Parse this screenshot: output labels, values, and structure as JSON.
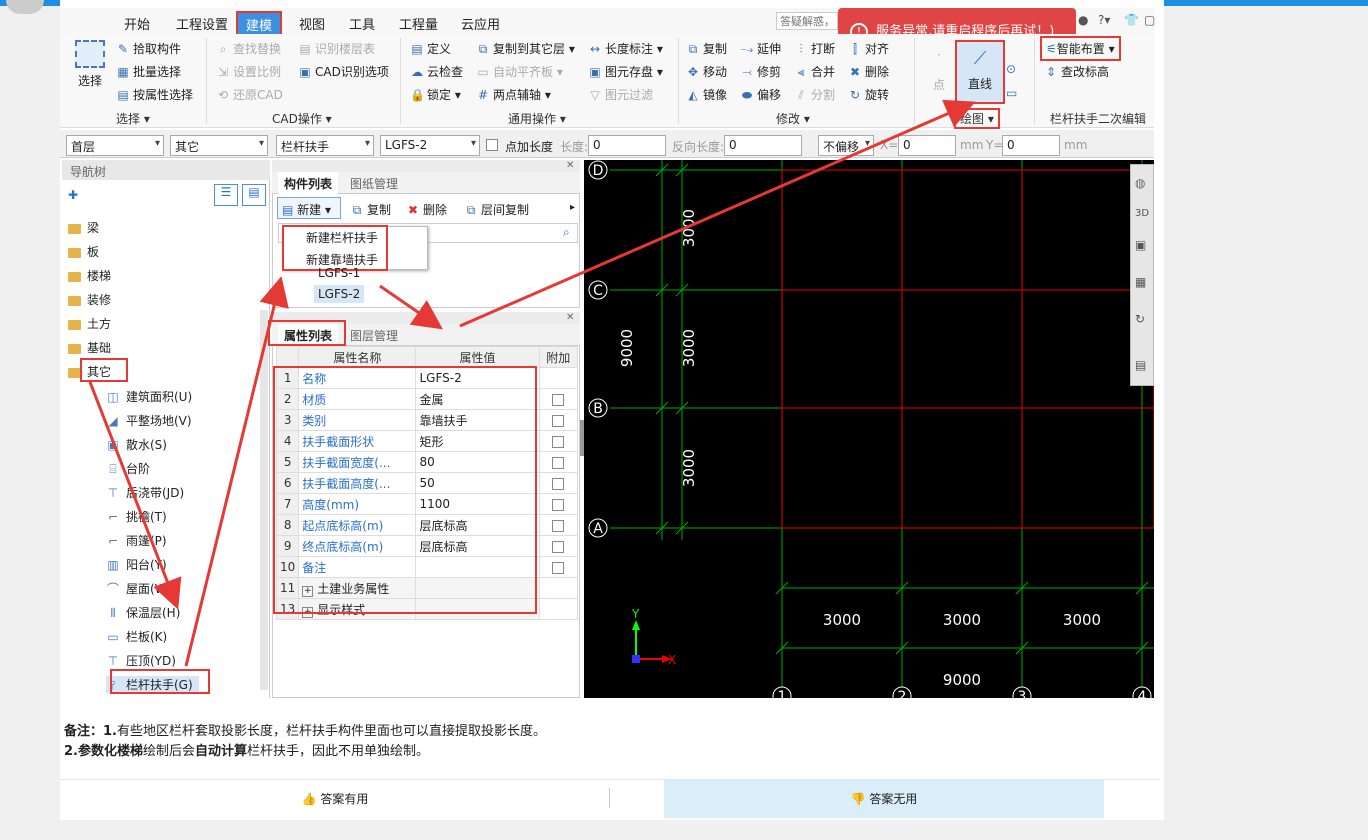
{
  "menu": {
    "items": [
      "开始",
      "工程设置",
      "建模",
      "视图",
      "工具",
      "工程量",
      "云应用"
    ],
    "active": "建模",
    "help_search_placeholder": "答疑解惑，自"
  },
  "popup": {
    "text": "服务异常,请重启程序后再试！)"
  },
  "ribbon": {
    "select_group": {
      "big_button": "选择",
      "items": [
        "拾取构件",
        "批量选择",
        "按属性选择"
      ],
      "label": "选择"
    },
    "cad_group": {
      "items": [
        "查找替换",
        "设置比例",
        "还原CAD",
        "识别楼层表",
        "CAD识别选项"
      ],
      "label": "CAD操作"
    },
    "common_group": {
      "items": [
        "定义",
        "云检查",
        "锁定",
        "复制到其它层",
        "自动平齐板",
        "两点辅轴",
        "长度标注",
        "图元存盘",
        "图元过滤"
      ],
      "label": "通用操作"
    },
    "modify_group": {
      "items": [
        "复制",
        "移动",
        "镜像",
        "延伸",
        "修剪",
        "偏移",
        "打断",
        "合并",
        "分割",
        "对齐",
        "删除",
        "旋转"
      ],
      "label": "修改"
    },
    "draw_group": {
      "items": [
        "点",
        "直线"
      ],
      "label": "绘图"
    },
    "rail_group": {
      "items": [
        "智能布置",
        "查改标高"
      ],
      "label": "栏杆扶手二次编辑"
    }
  },
  "toolbar2": {
    "floor": "首层",
    "category": "其它",
    "type": "栏杆扶手",
    "element": "LGFS-2",
    "checkbox_label": "点加长度",
    "length_label": "长度:",
    "length_value": "0",
    "rev_length_label": "反向长度:",
    "rev_length_value": "0",
    "offset": "不偏移",
    "x_label": "X=",
    "x_value": "0",
    "unit1": "mm",
    "y_label": "Y=",
    "y_value": "0",
    "unit2": "mm"
  },
  "nav": {
    "title": "导航树",
    "folders": [
      "梁",
      "板",
      "楼梯",
      "装修",
      "土方",
      "基础",
      "其它"
    ],
    "children": [
      "建筑面积(U)",
      "平整场地(V)",
      "散水(S)",
      "台阶",
      "后浇带(JD)",
      "挑檐(T)",
      "雨篷(P)",
      "阳台(Y)",
      "屋面(W)",
      "保温层(H)",
      "栏板(K)",
      "压顶(YD)",
      "栏杆扶手(G)"
    ]
  },
  "component_panel": {
    "tabs": [
      "构件列表",
      "图纸管理"
    ],
    "toolbar": [
      "新建",
      "复制",
      "删除",
      "层间复制"
    ],
    "dropdown": [
      "新建栏杆扶手",
      "新建靠墙扶手"
    ],
    "items": [
      "LGFS-1",
      "LGFS-2"
    ]
  },
  "property_panel": {
    "tabs": [
      "属性列表",
      "图层管理"
    ],
    "headers": [
      "属性名称",
      "属性值",
      "附加"
    ],
    "rows": [
      {
        "n": "1",
        "name": "名称",
        "value": "LGFS-2",
        "check": false
      },
      {
        "n": "2",
        "name": "材质",
        "value": "金属",
        "check": true
      },
      {
        "n": "3",
        "name": "类别",
        "value": "靠墙扶手",
        "check": true
      },
      {
        "n": "4",
        "name": "扶手截面形状",
        "value": "矩形",
        "check": true
      },
      {
        "n": "5",
        "name": "扶手截面宽度(...",
        "value": "80",
        "check": true
      },
      {
        "n": "6",
        "name": "扶手截面高度(...",
        "value": "50",
        "check": true
      },
      {
        "n": "7",
        "name": "高度(mm)",
        "value": "1100",
        "check": true
      },
      {
        "n": "8",
        "name": "起点底标高(m)",
        "value": "层底标高",
        "check": true
      },
      {
        "n": "9",
        "name": "终点底标高(m)",
        "value": "层底标高",
        "check": true
      },
      {
        "n": "10",
        "name": "备注",
        "value": "",
        "check": true
      },
      {
        "n": "11",
        "name": "土建业务属性",
        "value": "",
        "check": false
      },
      {
        "n": "13",
        "name": "显示样式",
        "value": "",
        "check": false
      }
    ]
  },
  "canvas": {
    "axis_rows": [
      "D",
      "C",
      "B",
      "A"
    ],
    "axis_cols": [
      "1",
      "2",
      "3",
      "4"
    ],
    "dims_vertical": [
      "3000",
      "3000",
      "3000",
      "9000"
    ],
    "dims_horizontal": [
      "3000",
      "3000",
      "3000",
      "9000"
    ],
    "x_label": "X",
    "y_label": "Y"
  },
  "note": {
    "prefix": "备注：",
    "line1_num": "1.",
    "line1": "有些地区栏杆套取投影长度，栏杆扶手构件里面也可以直接提取投影长度。",
    "line2_num": "2.",
    "line2_bold1": "参数化楼梯",
    "line2_mid": "绘制后会",
    "line2_bold2": "自动计算",
    "line2_end": "栏杆扶手，因此不用单独绘制。"
  },
  "feedback": {
    "useful": "答案有用",
    "useless": "答案无用"
  }
}
